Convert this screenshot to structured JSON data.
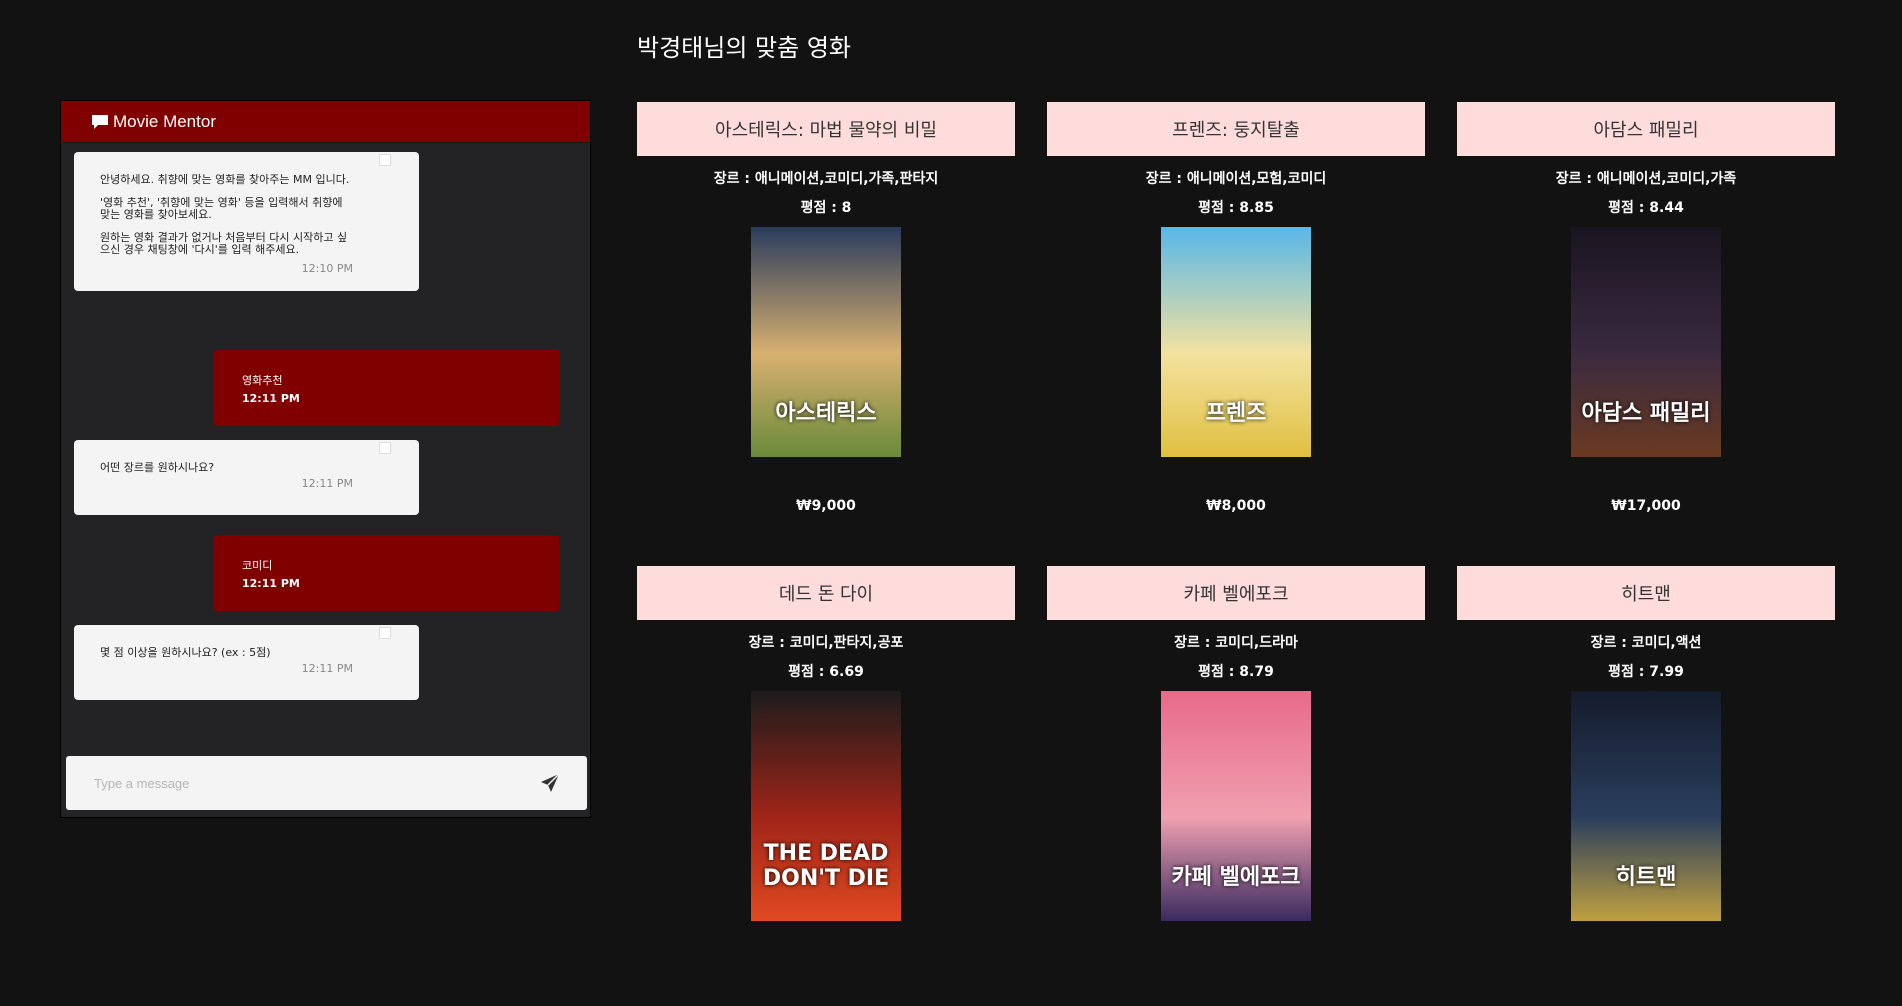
{
  "page": {
    "title": "박경태님의 맞춤 영화"
  },
  "chat": {
    "header": "Movie Mentor",
    "messages": [
      {
        "from": "bot",
        "lines": [
          "안녕하세요. 취향에 맞는 영화를 찾아주는 MM 입니다.",
          "'영화 추천', '취향에 맞는 영화' 등을 입력해서 취향에 맞는 영화를 찾아보세요.",
          "원하는 영화 결과가 없거나 처음부터 다시 시작하고 싶으신 경우 채팅창에 '다시'를 입력 해주세요."
        ],
        "time": "12:10 PM"
      },
      {
        "from": "user",
        "text": "영화추천",
        "time": "12:11 PM"
      },
      {
        "from": "bot",
        "lines": [
          "어떤 장르를 원하시나요?"
        ],
        "time": "12:11 PM"
      },
      {
        "from": "user",
        "text": "코미디",
        "time": "12:11 PM"
      },
      {
        "from": "bot",
        "lines": [
          "몇 점 이상을 원하시나요? (ex : 5점)"
        ],
        "time": "12:11 PM"
      }
    ],
    "input": {
      "value": "",
      "placeholder": "Type a message"
    },
    "icons": {
      "header": "chat-bubble-icon",
      "send": "paper-plane-icon"
    }
  },
  "movies": [
    {
      "title": "아스테릭스: 마법 물약의 비밀",
      "genre": "장르 : 애니메이션,코미디,가족,판타지",
      "rating": "평점 : 8",
      "price": "₩9,000",
      "poster_text": "아스테릭스",
      "poster_colors": [
        "#2a3b5c",
        "#d8b070",
        "#6a8a3a"
      ]
    },
    {
      "title": "프렌즈: 둥지탈출",
      "genre": "장르 : 애니메이션,모험,코미디",
      "rating": "평점 : 8.85",
      "price": "₩8,000",
      "poster_text": "프렌즈",
      "poster_colors": [
        "#58b7e8",
        "#f3e2a0",
        "#e0c040"
      ]
    },
    {
      "title": "아담스 패밀리",
      "genre": "장르 : 애니메이션,코미디,가족",
      "rating": "평점 : 8.44",
      "price": "₩17,000",
      "poster_text": "아담스 패밀리",
      "poster_colors": [
        "#1a1420",
        "#3a2a40",
        "#6a3a20"
      ]
    },
    {
      "title": "데드 돈 다이",
      "genre": "장르 : 코미디,판타지,공포",
      "rating": "평점 : 6.69",
      "price": "",
      "poster_text": "THE DEAD DON'T DIE",
      "poster_colors": [
        "#1c1c1c",
        "#a02418",
        "#e04a20"
      ]
    },
    {
      "title": "카페 벨에포크",
      "genre": "장르 : 코미디,드라마",
      "rating": "평점 : 8.79",
      "price": "",
      "poster_text": "카페 벨에포크",
      "poster_colors": [
        "#e86a8a",
        "#f0a0b0",
        "#3a2a60"
      ]
    },
    {
      "title": "히트맨",
      "genre": "장르 : 코미디,액션",
      "rating": "평점 : 7.99",
      "price": "",
      "poster_text": "히트맨",
      "poster_colors": [
        "#141c2c",
        "#2a3e5c",
        "#c0a040"
      ]
    }
  ]
}
